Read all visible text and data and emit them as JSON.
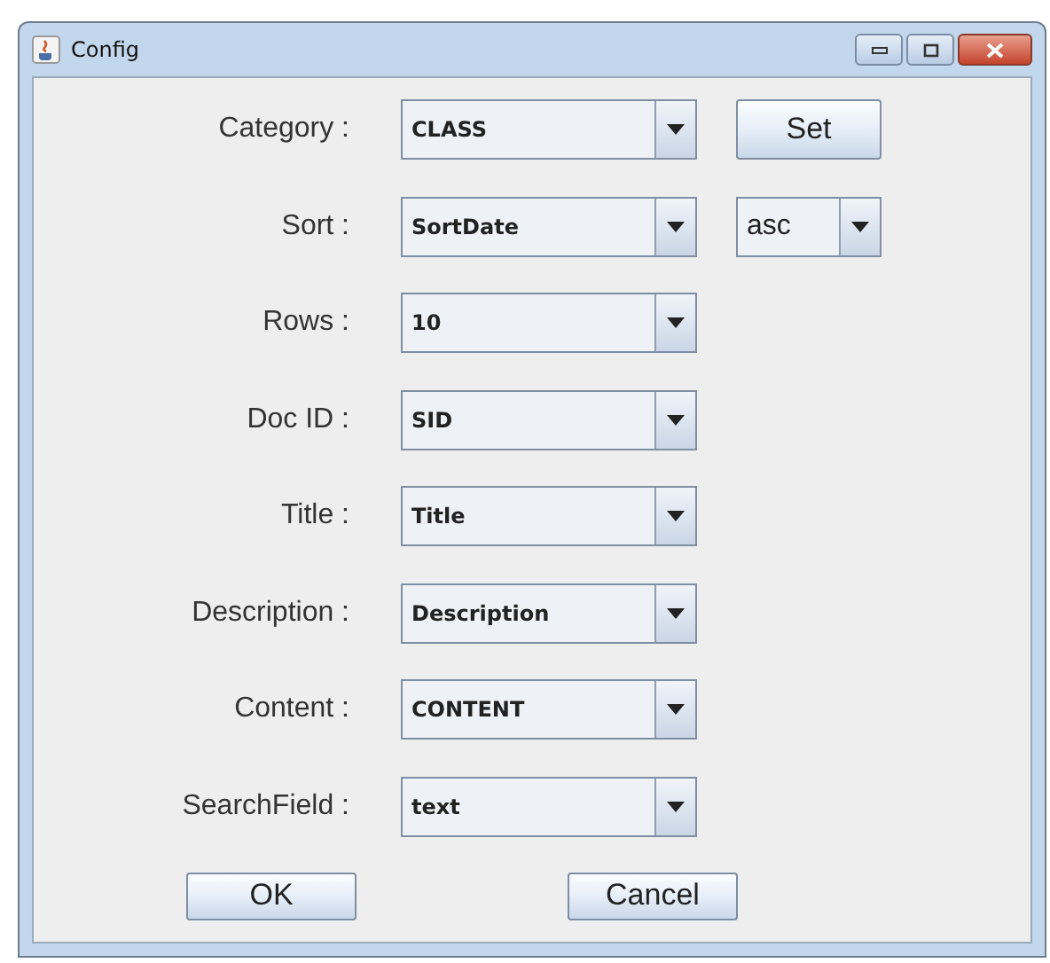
{
  "window": {
    "title": "Config"
  },
  "rows": [
    {
      "label": "Category :",
      "value": "CLASS",
      "extra": {
        "kind": "button",
        "label": "Set"
      }
    },
    {
      "label": "Sort :",
      "value": "SortDate",
      "extra": {
        "kind": "combo",
        "value": "asc"
      }
    },
    {
      "label": "Rows :",
      "value": "10"
    },
    {
      "label": "Doc ID :",
      "value": "SID"
    },
    {
      "label": "Title :",
      "value": "Title"
    },
    {
      "label": "Description :",
      "value": "Description"
    },
    {
      "label": "Content :",
      "value": "CONTENT"
    },
    {
      "label": "SearchField :",
      "value": "text"
    }
  ],
  "buttons": [
    "OK",
    "Cancel"
  ]
}
